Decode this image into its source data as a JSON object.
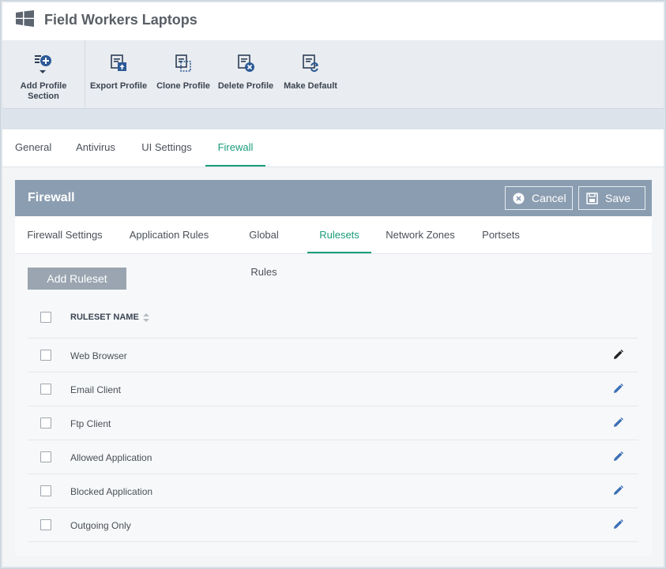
{
  "header": {
    "title": "Field Workers Laptops",
    "logo_icon": "windows-logo-icon"
  },
  "toolbar": {
    "items": [
      {
        "label": "Add Profile Section",
        "icon": "add-section-icon"
      },
      {
        "label": "Export Profile",
        "icon": "export-icon"
      },
      {
        "label": "Clone Profile",
        "icon": "clone-icon"
      },
      {
        "label": "Delete Profile",
        "icon": "delete-icon"
      },
      {
        "label": "Make Default",
        "icon": "make-default-icon"
      }
    ]
  },
  "top_tabs": [
    {
      "label": "General",
      "active": false
    },
    {
      "label": "Antivirus",
      "active": false
    },
    {
      "label": "UI Settings",
      "active": false
    },
    {
      "label": "Firewall",
      "active": true
    }
  ],
  "panel": {
    "title": "Firewall",
    "cancel_label": "Cancel",
    "save_label": "Save"
  },
  "sub_tabs": [
    {
      "label": "Firewall Settings",
      "active": false
    },
    {
      "label": "Application Rules",
      "active": false
    },
    {
      "label": "Global Rules",
      "active": false
    },
    {
      "label": "Rulesets",
      "active": true
    },
    {
      "label": "Network Zones",
      "active": false
    },
    {
      "label": "Portsets",
      "active": false
    }
  ],
  "add_ruleset_label": "Add Ruleset",
  "table": {
    "column_header": "RULESET NAME",
    "rows": [
      {
        "name": "Web Browser",
        "edit_icon_color": "#222222"
      },
      {
        "name": "Email Client",
        "edit_icon_color": "#3b6fb6"
      },
      {
        "name": "Ftp Client",
        "edit_icon_color": "#3b6fb6"
      },
      {
        "name": "Allowed Application",
        "edit_icon_color": "#3b6fb6"
      },
      {
        "name": "Blocked Application",
        "edit_icon_color": "#3b6fb6"
      },
      {
        "name": "Outgoing Only",
        "edit_icon_color": "#3b6fb6"
      }
    ]
  },
  "colors": {
    "accent": "#1a9c7a",
    "panel_header": "#8b9db1",
    "button_gray": "#9aa5b1"
  }
}
